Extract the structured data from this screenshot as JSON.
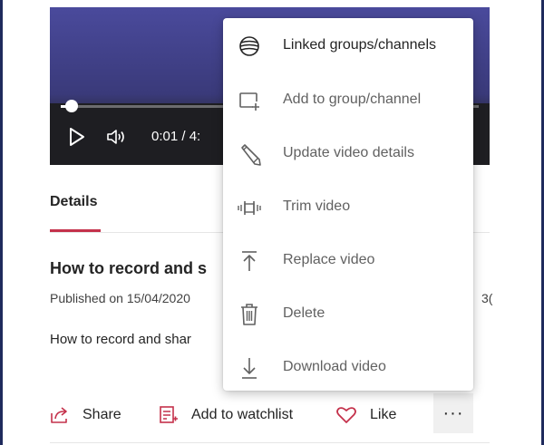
{
  "player": {
    "time_display": "0:01 / 4:",
    "progress_fraction": 0.025
  },
  "tabs": [
    {
      "label": "Details",
      "active": true
    }
  ],
  "video": {
    "title": "How to record and s",
    "published": "Published on 15/04/2020",
    "right_fragment": "3(",
    "description": "How to record and shar"
  },
  "actions": {
    "share": "Share",
    "watchlist": "Add to watchlist",
    "like": "Like",
    "more": "···"
  },
  "menu": {
    "items": [
      {
        "label": "Linked groups/channels",
        "icon": "globe-icon",
        "enabled": true
      },
      {
        "label": "Add to group/channel",
        "icon": "add-to-group-icon",
        "enabled": false
      },
      {
        "label": "Update video details",
        "icon": "pencil-icon",
        "enabled": false
      },
      {
        "label": "Trim video",
        "icon": "trim-icon",
        "enabled": false
      },
      {
        "label": "Replace video",
        "icon": "upload-icon",
        "enabled": false
      },
      {
        "label": "Delete",
        "icon": "trash-icon",
        "enabled": false
      },
      {
        "label": "Download video",
        "icon": "download-icon",
        "enabled": false
      }
    ]
  },
  "colors": {
    "accent": "#c4314b",
    "frame_border": "#1f2a5c",
    "video_top": "#4a4a9c",
    "controls_bg": "#1e1e22"
  }
}
